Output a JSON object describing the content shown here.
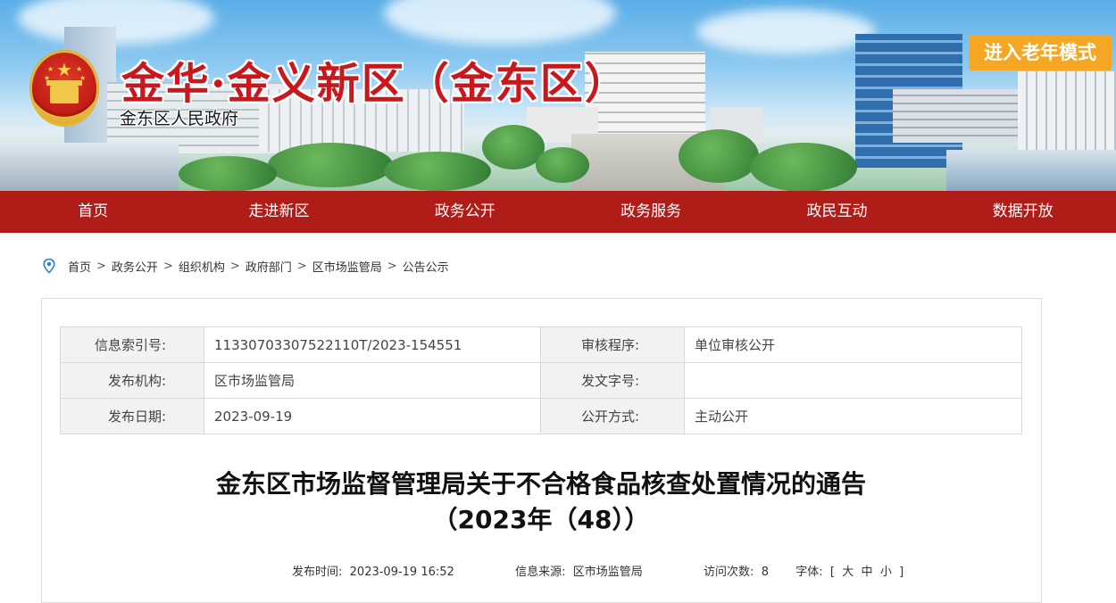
{
  "header": {
    "title": "金华·金义新区（金东区）",
    "subtitle": "金东区人民政府",
    "elder_mode_label": "进入老年模式"
  },
  "nav": {
    "items": [
      "首页",
      "走进新区",
      "政务公开",
      "政务服务",
      "政民互动",
      "数据开放"
    ]
  },
  "breadcrumb": [
    "首页",
    "政务公开",
    "组织机构",
    "政府部门",
    "区市场监管局",
    "公告公示"
  ],
  "breadcrumb_sep": ">",
  "meta": {
    "index_label": "信息索引号:",
    "index_value": "11330703307522110T/2023-154551",
    "review_label": "审核程序:",
    "review_value": "单位审核公开",
    "org_label": "发布机构:",
    "org_value": "区市场监管局",
    "docno_label": "发文字号:",
    "docno_value": "",
    "date_label": "发布日期:",
    "date_value": "2023-09-19",
    "open_label": "公开方式:",
    "open_value": "主动公开"
  },
  "article": {
    "title_line1": "金东区市场监督管理局关于不合格食品核查处置情况的通告",
    "title_line2": "（2023年（48））",
    "publish_time_label": "发布时间:",
    "publish_time": "2023-09-19 16:52",
    "source_label": "信息来源:",
    "source": "区市场监管局",
    "visits_label": "访问次数:",
    "visits": "8",
    "font_label": "字体:",
    "font_open": "[",
    "font_large": "大",
    "font_medium": "中",
    "font_small": "小",
    "font_close": "]"
  },
  "colors": {
    "nav_bg": "#b01d19",
    "title_red": "#c8171d",
    "elder_btn": "#f5a623"
  }
}
